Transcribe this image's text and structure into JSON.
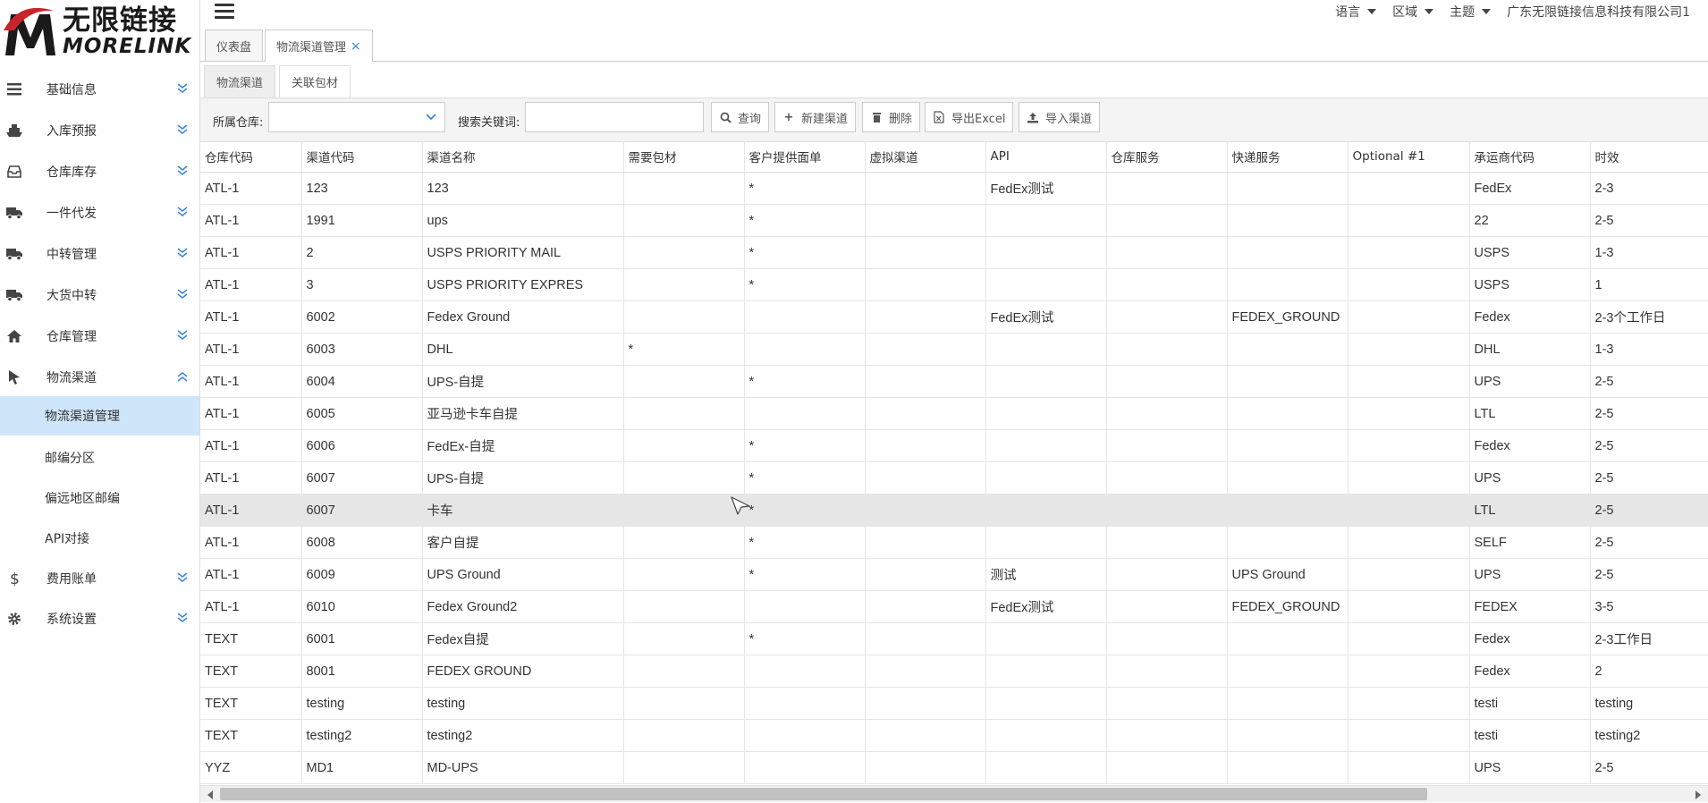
{
  "logo": {
    "cn": "无限链接",
    "en": "MORELINK",
    "brand_color": "#c8242b"
  },
  "sidebar": {
    "menu": [
      {
        "label": "基础信息",
        "icon": "list-icon",
        "expanded": false
      },
      {
        "label": "入库预报",
        "icon": "ship-icon",
        "expanded": false
      },
      {
        "label": "仓库库存",
        "icon": "inbox-icon",
        "expanded": false
      },
      {
        "label": "一件代发",
        "icon": "truck-icon",
        "expanded": false
      },
      {
        "label": "中转管理",
        "icon": "truck-icon",
        "expanded": false
      },
      {
        "label": "大货中转",
        "icon": "truck-icon",
        "expanded": false
      },
      {
        "label": "仓库管理",
        "icon": "home-icon",
        "expanded": false
      },
      {
        "label": "物流渠道",
        "icon": "pointer-icon",
        "expanded": true
      },
      {
        "label": "费用账单",
        "icon": "dollar-icon",
        "expanded": false
      },
      {
        "label": "系统设置",
        "icon": "gear-icon",
        "expanded": false
      }
    ],
    "submenu": [
      {
        "label": "物流渠道管理",
        "active": true
      },
      {
        "label": "邮编分区",
        "active": false
      },
      {
        "label": "偏远地区邮编",
        "active": false
      },
      {
        "label": "API对接",
        "active": false
      }
    ]
  },
  "topbar": {
    "language": "语言",
    "region": "区域",
    "theme": "主题",
    "company": "广东无限链接信息科技有限公司1"
  },
  "page_tabs": {
    "dashboard": "仪表盘",
    "current": "物流渠道管理",
    "close": "×"
  },
  "inner_tabs": {
    "channel": "物流渠道",
    "package": "关联包材"
  },
  "toolbar": {
    "warehouse_label": "所属仓库:",
    "warehouse_value": "",
    "keyword_label": "搜索关键词:",
    "keyword_value": "",
    "query": "查询",
    "new": "新建渠道",
    "delete": "删除",
    "export": "导出Excel",
    "import": "导入渠道"
  },
  "table": {
    "columns": [
      "仓库代码",
      "渠道代码",
      "渠道名称",
      "需要包材",
      "客户提供面单",
      "虚拟渠道",
      "API",
      "仓库服务",
      "快递服务",
      "Optional #1",
      "承运商代码",
      "时效"
    ],
    "rows": [
      [
        "ATL-1",
        "123",
        "123",
        "",
        "*",
        "",
        "FedEx测试",
        "",
        "",
        "",
        "FedEx",
        "2-3"
      ],
      [
        "ATL-1",
        "1991",
        "ups",
        "",
        "*",
        "",
        "",
        "",
        "",
        "",
        "22",
        "2-5"
      ],
      [
        "ATL-1",
        "2",
        "USPS PRIORITY MAIL",
        "",
        "*",
        "",
        "",
        "",
        "",
        "",
        "USPS",
        "1-3"
      ],
      [
        "ATL-1",
        "3",
        "USPS PRIORITY EXPRES",
        "",
        "*",
        "",
        "",
        "",
        "",
        "",
        "USPS",
        "1"
      ],
      [
        "ATL-1",
        "6002",
        "Fedex Ground",
        "",
        "",
        "",
        "FedEx测试",
        "",
        "FEDEX_GROUND",
        "",
        "Fedex",
        "2-3个工作日"
      ],
      [
        "ATL-1",
        "6003",
        "DHL",
        "*",
        "",
        "",
        "",
        "",
        "",
        "",
        "DHL",
        "1-3"
      ],
      [
        "ATL-1",
        "6004",
        "UPS-自提",
        "",
        "*",
        "",
        "",
        "",
        "",
        "",
        "UPS",
        "2-5"
      ],
      [
        "ATL-1",
        "6005",
        "亚马逊卡车自提",
        "",
        "",
        "",
        "",
        "",
        "",
        "",
        "LTL",
        "2-5"
      ],
      [
        "ATL-1",
        "6006",
        "FedEx-自提",
        "",
        "*",
        "",
        "",
        "",
        "",
        "",
        "Fedex",
        "2-5"
      ],
      [
        "ATL-1",
        "6007",
        "UPS-自提",
        "",
        "*",
        "",
        "",
        "",
        "",
        "",
        "UPS",
        "2-5"
      ],
      [
        "ATL-1",
        "6007",
        "卡车",
        "",
        "*",
        "",
        "",
        "",
        "",
        "",
        "LTL",
        "2-5"
      ],
      [
        "ATL-1",
        "6008",
        "客户自提",
        "",
        "*",
        "",
        "",
        "",
        "",
        "",
        "SELF",
        "2-5"
      ],
      [
        "ATL-1",
        "6009",
        "UPS Ground",
        "",
        "*",
        "",
        "测试",
        "",
        "UPS Ground",
        "",
        "UPS",
        "2-5"
      ],
      [
        "ATL-1",
        "6010",
        "Fedex Ground2",
        "",
        "",
        "",
        "FedEx测试",
        "",
        "FEDEX_GROUND",
        "",
        "FEDEX",
        "3-5"
      ],
      [
        "TEXT",
        "6001",
        "Fedex自提",
        "",
        "*",
        "",
        "",
        "",
        "",
        "",
        "Fedex",
        "2-3工作日"
      ],
      [
        "TEXT",
        "8001",
        "FEDEX GROUND",
        "",
        "",
        "",
        "",
        "",
        "",
        "",
        "Fedex",
        "2"
      ],
      [
        "TEXT",
        "testing",
        "testing",
        "",
        "",
        "",
        "",
        "",
        "",
        "",
        "testi",
        "testing"
      ],
      [
        "TEXT",
        "testing2",
        "testing2",
        "",
        "",
        "",
        "",
        "",
        "",
        "",
        "testi",
        "testing2"
      ],
      [
        "YYZ",
        "MD1",
        "MD-UPS",
        "",
        "",
        "",
        "",
        "",
        "",
        "",
        "UPS",
        "2-5"
      ]
    ],
    "highlight_row": 10
  }
}
